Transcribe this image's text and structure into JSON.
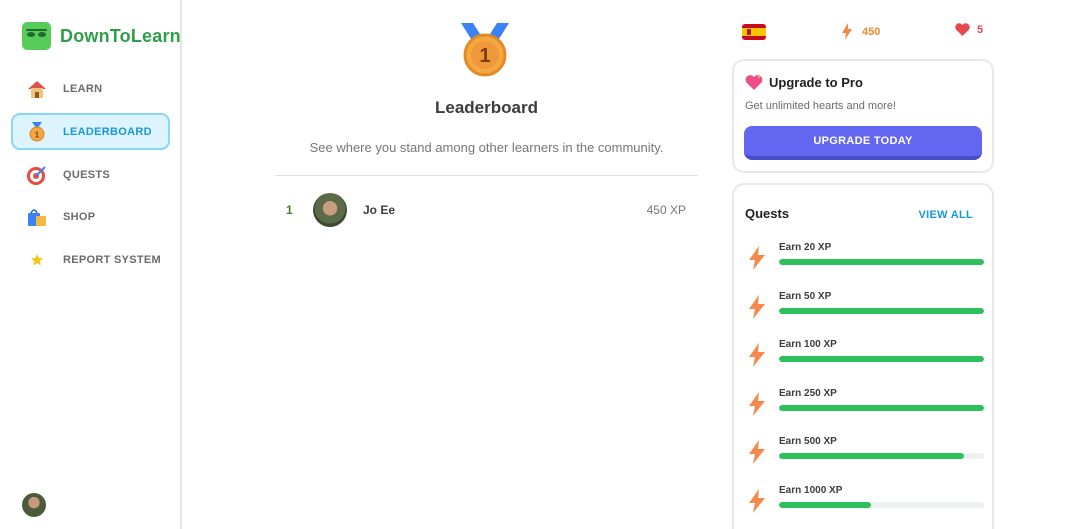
{
  "brand": {
    "name": "DownToLearn"
  },
  "nav": [
    {
      "id": "learn",
      "label": "LEARN",
      "icon": "house-icon",
      "active": false
    },
    {
      "id": "leaderboard",
      "label": "LEADERBOARD",
      "icon": "medal-icon",
      "active": true
    },
    {
      "id": "quests",
      "label": "QUESTS",
      "icon": "target-icon",
      "active": false
    },
    {
      "id": "shop",
      "label": "SHOP",
      "icon": "shopping-bags-icon",
      "active": false
    },
    {
      "id": "report",
      "label": "REPORT SYSTEM",
      "icon": "star-icon",
      "active": false
    }
  ],
  "main": {
    "medal_rank": "1",
    "title": "Leaderboard",
    "subtitle": "See where you stand among other learners in the community.",
    "leaderboard": [
      {
        "rank": "1",
        "name": "Jo Ee",
        "xp": "450 XP"
      }
    ]
  },
  "stats": {
    "language_flag": "spain-flag-icon",
    "xp": "450",
    "hearts": "5"
  },
  "pro": {
    "title": "Upgrade to Pro",
    "description": "Get unlimited hearts and more!",
    "button": "UPGRADE TODAY"
  },
  "quests": {
    "title": "Quests",
    "view_all": "VIEW ALL",
    "items": [
      {
        "label": "Earn 20 XP",
        "progress": 1.0
      },
      {
        "label": "Earn 50 XP",
        "progress": 1.0
      },
      {
        "label": "Earn 100 XP",
        "progress": 1.0
      },
      {
        "label": "Earn 250 XP",
        "progress": 1.0
      },
      {
        "label": "Earn 500 XP",
        "progress": 0.9
      },
      {
        "label": "Earn 1000 XP",
        "progress": 0.45
      }
    ]
  },
  "colors": {
    "brand_green": "#2e9e48",
    "active_blue": "#1899d6",
    "upgrade_purple": "#6366f1",
    "progress_green": "#2ec05c",
    "xp_orange": "#f08a30",
    "heart_red": "#e5484d"
  }
}
